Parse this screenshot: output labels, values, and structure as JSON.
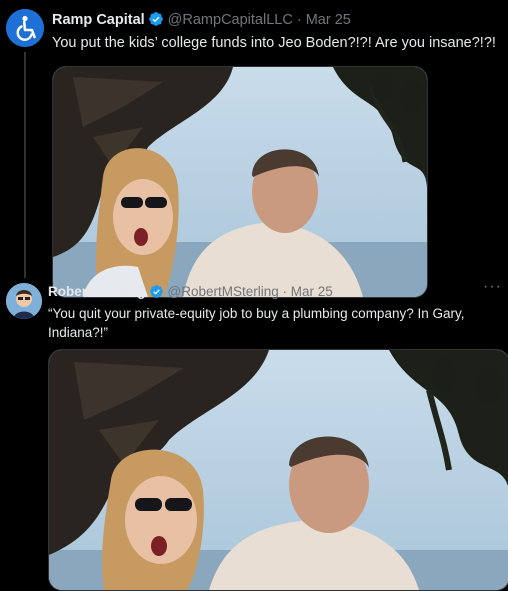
{
  "tweets": [
    {
      "name": "Ramp Capital",
      "handle": "@RampCapitalLLC",
      "separator": "·",
      "date": "Mar 25",
      "text": "You put the kids’ college funds into Jeo Boden?!?! Are you insane?!?!",
      "avatar_icon": "wheelchair-icon",
      "verified_icon": "verified-badge-icon",
      "photo_desc_icon": "photo-icon"
    },
    {
      "name": "Robert Sterling",
      "handle": "@RobertMSterling",
      "separator": "·",
      "date": "Mar 25",
      "text": "“You quit your private-equity job to buy a plumbing company? In Gary, Indiana?!”",
      "more_label": "···",
      "avatar_icon": "cartoon-avatar-icon",
      "verified_icon": "verified-badge-icon",
      "photo_desc_icon": "photo-icon"
    }
  ],
  "colors": {
    "background": "#000000",
    "text": "#e7e9ea",
    "muted": "#71767b",
    "verified": "#1d9bf0",
    "thread_line": "#2f3336"
  }
}
